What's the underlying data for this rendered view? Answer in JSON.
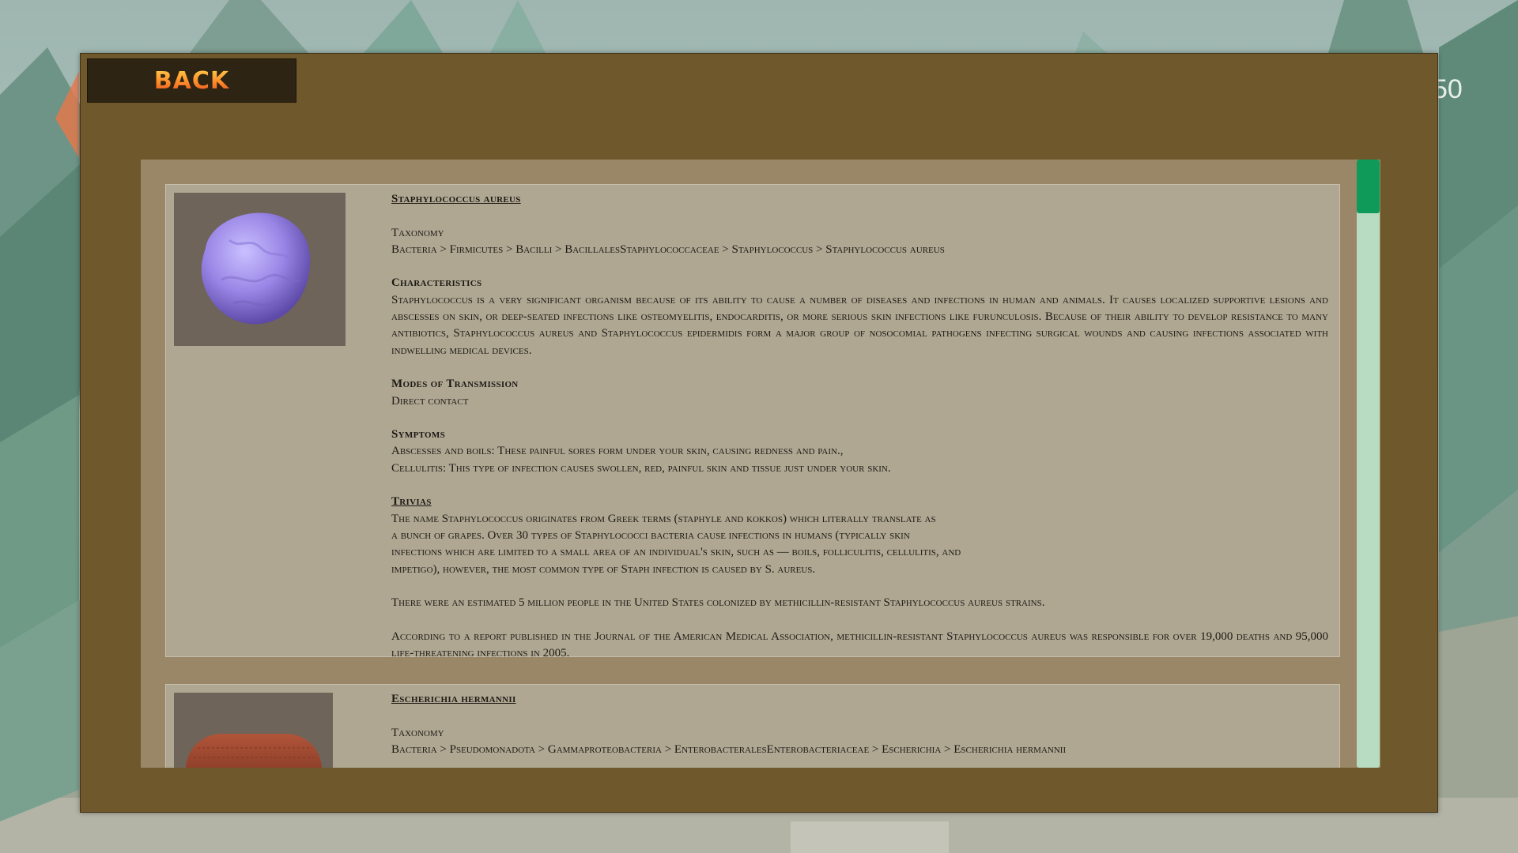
{
  "hud": {
    "counter": "50"
  },
  "back_button": {
    "label": "BACK"
  },
  "entries": [
    {
      "name": "Staphylococcus aureus",
      "taxonomy_heading": "Taxonomy",
      "taxonomy": "Bacteria > Firmicutes > Bacilli > BacillalesStaphylococcaceae  > Staphylococcus > Staphylococcus aureus",
      "characteristics_heading": "Characteristics",
      "characteristics": "Staphylococcus is a very significant organism because of its ability to cause a number of diseases and infections in human and animals. It causes localized supportive lesions and abscesses on skin, or deep-seated infections like osteomyelitis, endocarditis, or more serious skin infections like furunculosis. Because of their ability to develop resistance to many antibiotics, Staphylococcus aureus and Staphylococcus epidermidis form a major group of nosocomial pathogens infecting surgical wounds and causing infections associated with indwelling medical devices.",
      "transmission_heading": "Modes of Transmission",
      "transmission": "Direct contact",
      "symptoms_heading": "Symptoms",
      "symptoms": [
        "Abscesses and boils: These painful sores form under your skin, causing redness and pain.,",
        "Cellulitis: This type of infection causes swollen, red, painful skin and tissue just under your skin."
      ],
      "trivias_heading": "Trivias",
      "trivia_lines": [
        "The name Staphylococcus originates from Greek terms (staphyle and kokkos) which literally translate as",
        "a bunch of grapes. Over 30 types of Staphylococci bacteria cause infections in humans (typically skin",
        "infections which are limited to a small area of an individual's skin, such as — boils, folliculitis, cellulitis, and",
        "impetigo), however, the most common type of Staph infection is caused by S. aureus."
      ],
      "trivia_2": "There were an estimated 5 million people in the United States colonized by methicillin-resistant Staphylococcus aureus strains.",
      "trivia_3": "According to a report published in the Journal of the American Medical Association, methicillin-resistant Staphylococcus aureus was responsible for over 19,000 deaths and 95,000 life-threatening infections in 2005."
    },
    {
      "name": "Escherichia hermannii",
      "taxonomy_heading": "Taxonomy",
      "taxonomy": "Bacteria > Pseudomonadota > Gammaproteobacteria > EnterobacteralesEnterobacteriaceae > Escherichia > Escherichia hermannii"
    }
  ],
  "scrollbar": {
    "position": 0.0
  },
  "colors": {
    "panel": "#6f582c",
    "scroll_view": "#9a8767",
    "card": "#b0a793",
    "scrollbar_track": "#b7dcc1",
    "scrollbar_thumb": "#0f9a5a",
    "back_text": "#ff8a2a"
  }
}
